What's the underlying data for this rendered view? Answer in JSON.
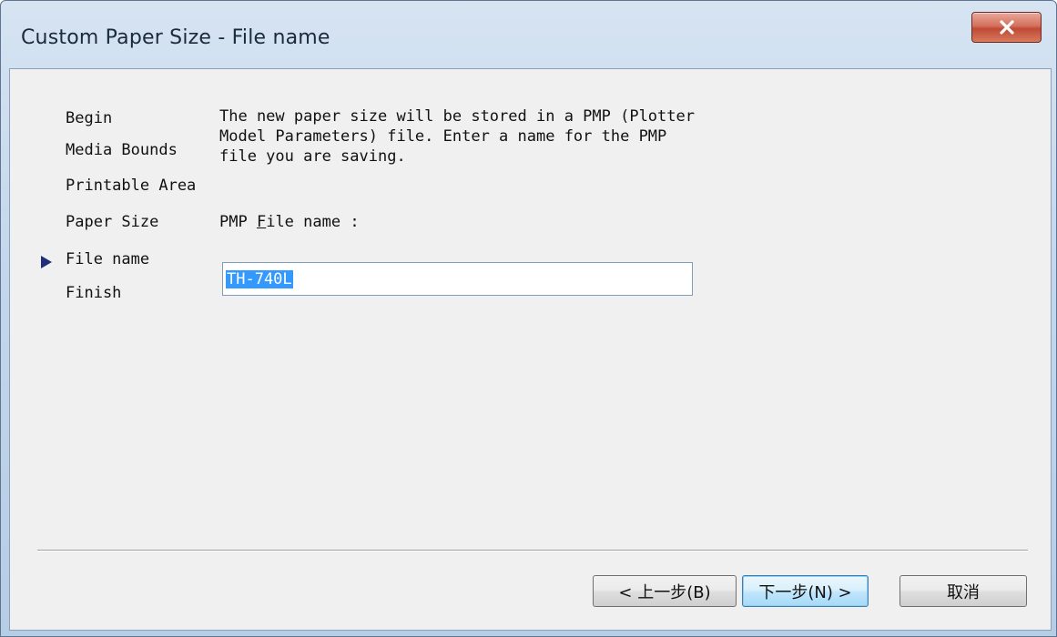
{
  "window": {
    "title": "Custom Paper Size - File name",
    "close_label": "×"
  },
  "steps": [
    {
      "label": "Begin",
      "current": false
    },
    {
      "label": "Media Bounds",
      "current": false
    },
    {
      "label": "Printable Area",
      "current": false
    },
    {
      "label": "Paper Size",
      "current": false
    },
    {
      "label": "File name",
      "current": true
    },
    {
      "label": "Finish",
      "current": false
    }
  ],
  "content": {
    "description_lines": [
      "The new paper size will be stored in a PMP (Plotter",
      "Model Parameters) file. Enter a name for the PMP",
      "file you are saving."
    ],
    "field_label_prefix": "PMP ",
    "field_label_accel": "F",
    "field_label_suffix": "ile name :",
    "file_name_value": "TH-740L"
  },
  "buttons": {
    "back": "< 上一步(B)",
    "next": "下一步(N) >",
    "cancel": "取消"
  },
  "colors": {
    "title_bar": "#c4d7ec",
    "close_button": "#c04a35",
    "selection": "#3399ff",
    "current_step_arrow": "#1f2f7a"
  }
}
